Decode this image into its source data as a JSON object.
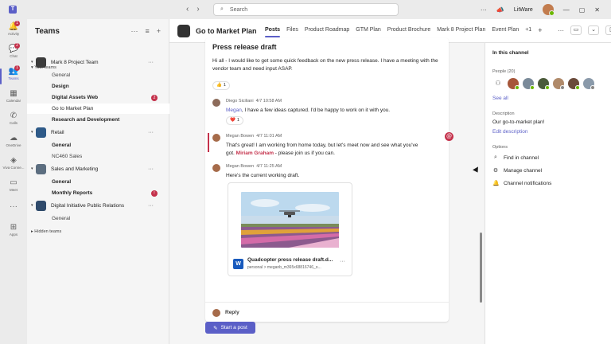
{
  "search": {
    "placeholder": "Search"
  },
  "org": {
    "name": "LitWare"
  },
  "rail": [
    {
      "label": "Activity",
      "icon": "bell-icon",
      "badge": "1"
    },
    {
      "label": "Chat",
      "icon": "chat-icon",
      "badge": "2"
    },
    {
      "label": "Teams",
      "icon": "teams-icon",
      "badge": "1",
      "active": true
    },
    {
      "label": "Calendar",
      "icon": "calendar-icon"
    },
    {
      "label": "Calls",
      "icon": "phone-icon"
    },
    {
      "label": "OneDrive",
      "icon": "cloud-icon"
    },
    {
      "label": "Viva Conne...",
      "icon": "viva-icon"
    },
    {
      "label": "Meet",
      "icon": "video-icon"
    },
    {
      "label": "Apps",
      "icon": "apps-icon"
    }
  ],
  "pane": {
    "title": "Teams",
    "your_teams": "Your teams",
    "hidden_teams": "Hidden teams",
    "teams": [
      {
        "name": "Mark 8 Project Team",
        "color": "#3b3b3b",
        "channels": [
          {
            "name": "General"
          },
          {
            "name": "Design",
            "bold": true
          },
          {
            "name": "Digital Assets Web",
            "bold": true,
            "badge": "2"
          },
          {
            "name": "Go to Market Plan",
            "selected": true
          },
          {
            "name": "Research and Development",
            "bold": true
          }
        ]
      },
      {
        "name": "Retail",
        "color": "#2e5a88",
        "channels": [
          {
            "name": "General",
            "bold": true
          },
          {
            "name": "NC460 Sales"
          }
        ]
      },
      {
        "name": "Sales and Marketing",
        "color": "#5c6e80",
        "channels": [
          {
            "name": "General",
            "bold": true
          },
          {
            "name": "Monthly Reports",
            "bold": true,
            "badge": "!"
          }
        ]
      },
      {
        "name": "Digital Initiative Public Relations",
        "color": "#2f4a6b",
        "channels": [
          {
            "name": "General"
          }
        ]
      }
    ]
  },
  "channel": {
    "title": "Go to Market Plan",
    "tabs": [
      "Posts",
      "Files",
      "Product Roadmap",
      "GTM Plan",
      "Product Brochure",
      "Mark 8 Project Plan",
      "Event Plan",
      "+1"
    ]
  },
  "post": {
    "title": "Press release draft",
    "body": "Hi all - I would like to get some quick feedback on the new press release. I have a meeting with the vendor team and need input ASAP.",
    "reaction": {
      "emoji": "👍",
      "count": "1"
    },
    "replies": [
      {
        "author": "Diego Siciliani",
        "time": "4/7 10:58 AM",
        "mention": "Megan",
        "text": ", I have a few ideas captured. I'd be happy to work on it with you.",
        "reaction": {
          "emoji": "❤️",
          "count": "1"
        }
      },
      {
        "author": "Megan Bowen",
        "time": "4/7 11:01 AM",
        "text_a": "That's great! I am working from home today, but let's meet now and see what you've",
        "text_b_pre": "got. ",
        "urgent_mention": "Miriam Graham",
        "text_b_post": " - please join us if you can."
      },
      {
        "author": "Megan Bowen",
        "time": "4/7 11:25 AM",
        "text": "Here's the current working draft."
      }
    ],
    "file": {
      "name": "Quadcopter press release draft.d...",
      "path": "personal > meganb_m365x68816746_o..."
    },
    "reply_label": "Reply"
  },
  "start_post": "Start a post",
  "panel": {
    "title": "In this channel",
    "people_label": "People (20)",
    "see_all": "See all",
    "desc_label": "Description",
    "description": "Our go-to-market plan!",
    "edit_desc": "Edit description",
    "options_label": "Options",
    "options": [
      "Find in channel",
      "Manage channel",
      "Channel notifications"
    ]
  },
  "colors": {
    "brand": "#5b5fc7",
    "urgent": "#c4314b"
  }
}
